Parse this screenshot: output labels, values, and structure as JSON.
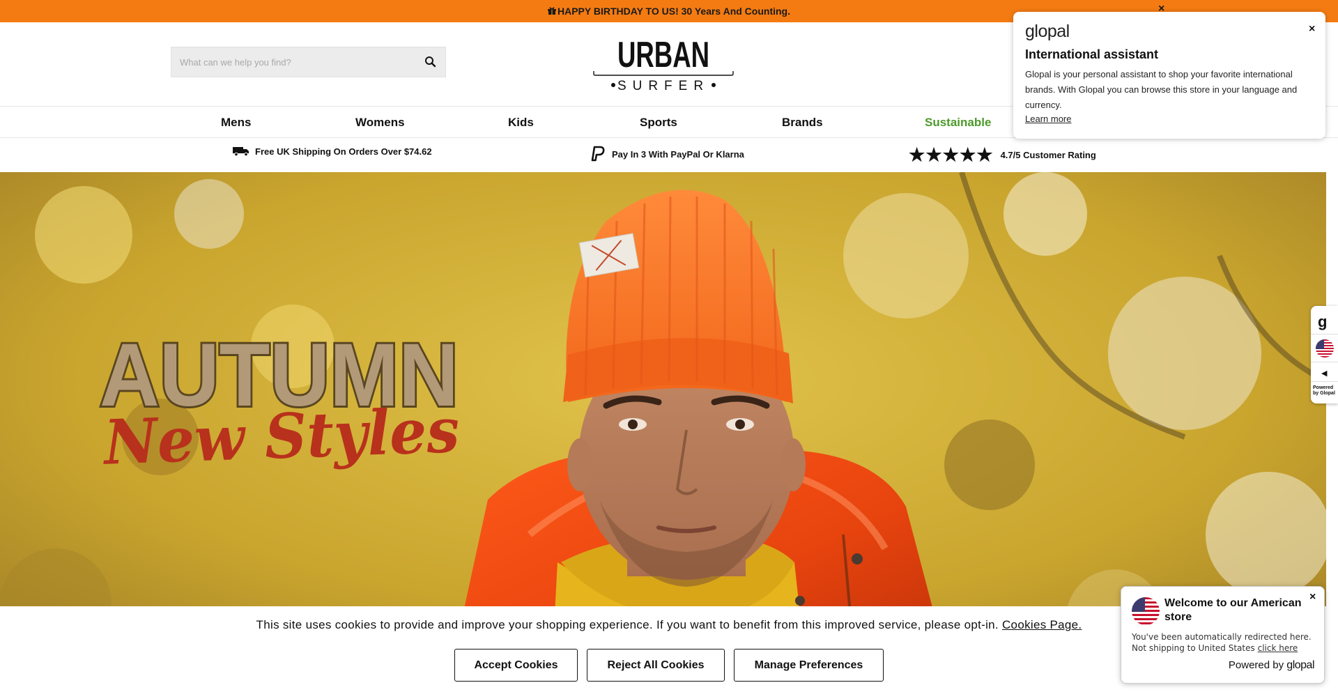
{
  "announcement": {
    "text": "HAPPY BIRTHDAY TO US! 30 Years And Counting.",
    "close": "×"
  },
  "header": {
    "search_placeholder": "What can we help you find?",
    "logo_top": "URBAN",
    "logo_bottom": "SURFER"
  },
  "nav": {
    "items": [
      {
        "label": "Mens"
      },
      {
        "label": "Womens"
      },
      {
        "label": "Kids"
      },
      {
        "label": "Sports"
      },
      {
        "label": "Brands"
      },
      {
        "label": "Sustainable"
      }
    ],
    "highlight_color": "#4c9a2a"
  },
  "usp": {
    "shipping": "Free UK Shipping On Orders Over $74.62",
    "paypal": "Pay In 3 With PayPal Or Klarna",
    "rating": "4.7/5 Customer Rating",
    "stars": 5
  },
  "hero": {
    "headline": "AUTUMN",
    "subheadline": "New Styles"
  },
  "cookie": {
    "text": "This site uses cookies to provide and improve your shopping experience. If you want to benefit from this improved service, please opt-in.",
    "link": "Cookies Page.",
    "accept": "Accept Cookies",
    "reject": "Reject All Cookies",
    "manage": "Manage Preferences"
  },
  "assistant": {
    "brand": "glopal",
    "title": "International assistant",
    "body": "Glopal is your personal assistant to shop your favorite international brands. With Glopal you can browse this store in your language and currency.",
    "link": "Learn more",
    "close": "×"
  },
  "sidetab": {
    "logo": "g",
    "arrow": "◀",
    "powered": "Powered by Glopal"
  },
  "welcome": {
    "title": "Welcome to our American store",
    "line1": "You've been automatically redirected here.",
    "line2_prefix": "Not shipping to United States",
    "line2_link": "click here",
    "powered_prefix": "Powered by",
    "powered_brand": "glopal",
    "close": "×"
  },
  "colors": {
    "announcement_bg": "#f47b12",
    "sustainable": "#4c9a2a"
  }
}
